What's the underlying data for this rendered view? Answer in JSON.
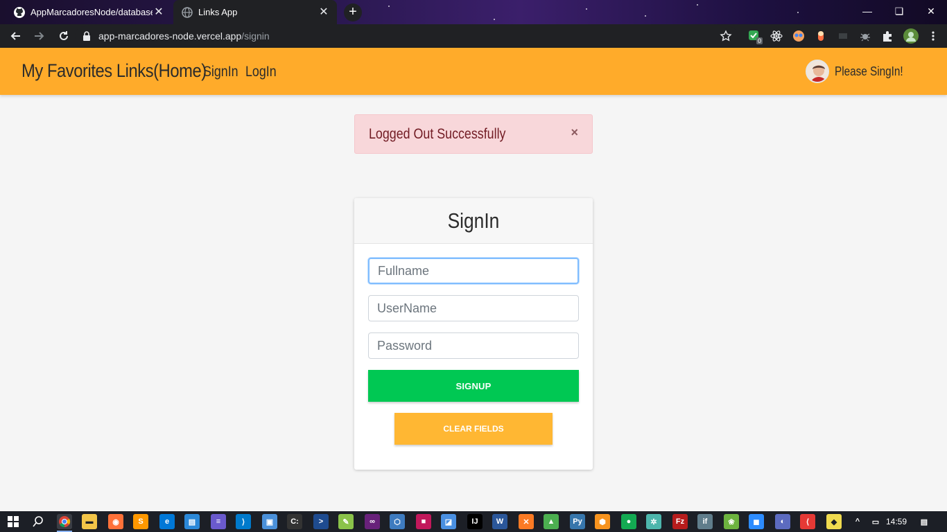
{
  "browser": {
    "tabs": [
      {
        "title": "AppMarcadoresNode/database.js",
        "active": false
      },
      {
        "title": "Links App",
        "active": true
      }
    ],
    "url_host": "app-marcadores-node.vercel.app",
    "url_path": "/signin",
    "extension_badge": "0"
  },
  "navbar": {
    "brand": "My Favorites Links(Home)",
    "links": [
      "SignIn",
      "LogIn"
    ],
    "user_text": "Please SingIn!",
    "bg_color": "#ffab2a"
  },
  "alert": {
    "message": "Logged Out Successfully",
    "close_symbol": "×"
  },
  "form": {
    "title": "SignIn",
    "fullname_placeholder": "Fullname",
    "username_placeholder": "UserName",
    "password_placeholder": "Password",
    "signup_label": "SIGNUP",
    "clear_label": "CLEAR FIELDS"
  },
  "taskbar": {
    "time": "14:59"
  }
}
